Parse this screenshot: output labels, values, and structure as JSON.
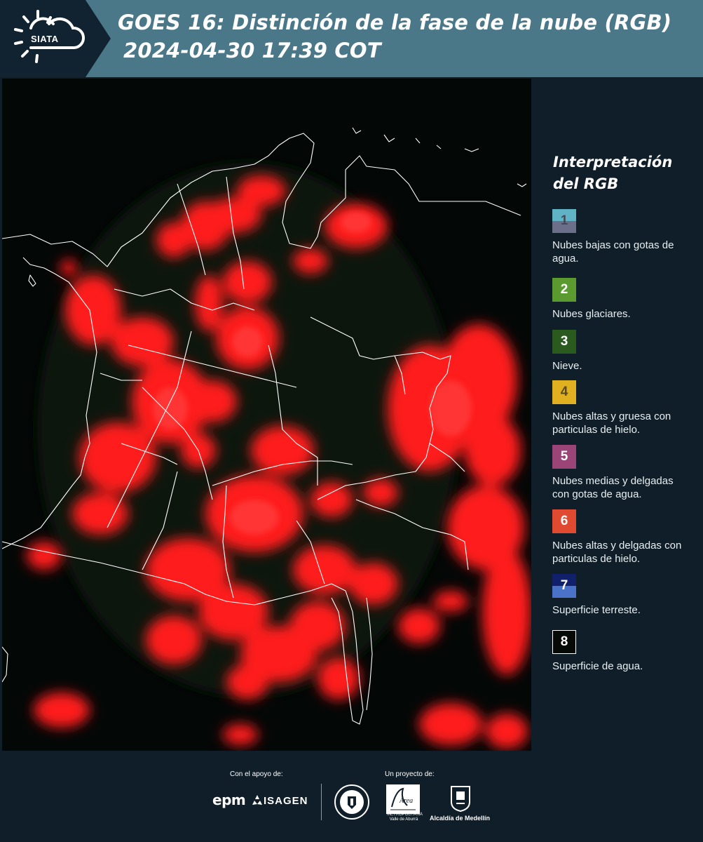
{
  "header": {
    "logo_text": "SIATA",
    "title_line1": "GOES 16: Distinción de la fase de la nube (RGB)",
    "title_line2": "2024-04-30 17:39 COT"
  },
  "legend": {
    "title": "Interpretación del RGB",
    "items": [
      {
        "number": "1",
        "label": "Nubes bajas con gotas de agua.",
        "color_top": "#5fb3c4",
        "color_bottom": "#6b6f8a",
        "num_color": "#444a5a"
      },
      {
        "number": "2",
        "label": "Nubes glaciares.",
        "color_top": "#5a9a2e",
        "color_bottom": "#5a9a2e",
        "num_color": "#ffffff"
      },
      {
        "number": "3",
        "label": "Nieve.",
        "color_top": "#2a5a1e",
        "color_bottom": "#2a5a1e",
        "num_color": "#ffffff"
      },
      {
        "number": "4",
        "label": "Nubes altas y gruesa con particulas de hielo.",
        "color_top": "#e0b020",
        "color_bottom": "#e0b020",
        "num_color": "#5a4a20"
      },
      {
        "number": "5",
        "label": "Nubes medias y delgadas con gotas de agua.",
        "color_top": "#9a4478",
        "color_bottom": "#9a4478",
        "num_color": "#ffffff"
      },
      {
        "number": "6",
        "label": "Nubes altas y delgadas con particulas de hielo.",
        "color_top": "#e04a30",
        "color_bottom": "#e04a30",
        "num_color": "#ffffff"
      },
      {
        "number": "7",
        "label": "Superficie terreste.",
        "color_top": "#10206a",
        "color_bottom": "#4a72c8",
        "num_color": "#ffffff"
      },
      {
        "number": "8",
        "label": "Superficie de agua.",
        "color_top": "#050a06",
        "color_bottom": "#050a06",
        "num_color": "#ffffff",
        "border": "#ffffff"
      }
    ]
  },
  "footer": {
    "support_label": "Con el apoyo de:",
    "project_label": "Un proyecto de:",
    "sponsor_1": "epm",
    "sponsor_2": "ISAGEN",
    "partner_area_name": "Área",
    "partner_area_sub": "METROPOLITANA Valle de Aburrá",
    "partner_alcaldia": "Alcaldía de Medellín"
  },
  "colors": {
    "header_bg": "#4b7888",
    "logo_bg": "#112330",
    "page_bg": "#0f1e28",
    "cloud_red": "#ff1a1a",
    "border_white": "#ffffff"
  }
}
